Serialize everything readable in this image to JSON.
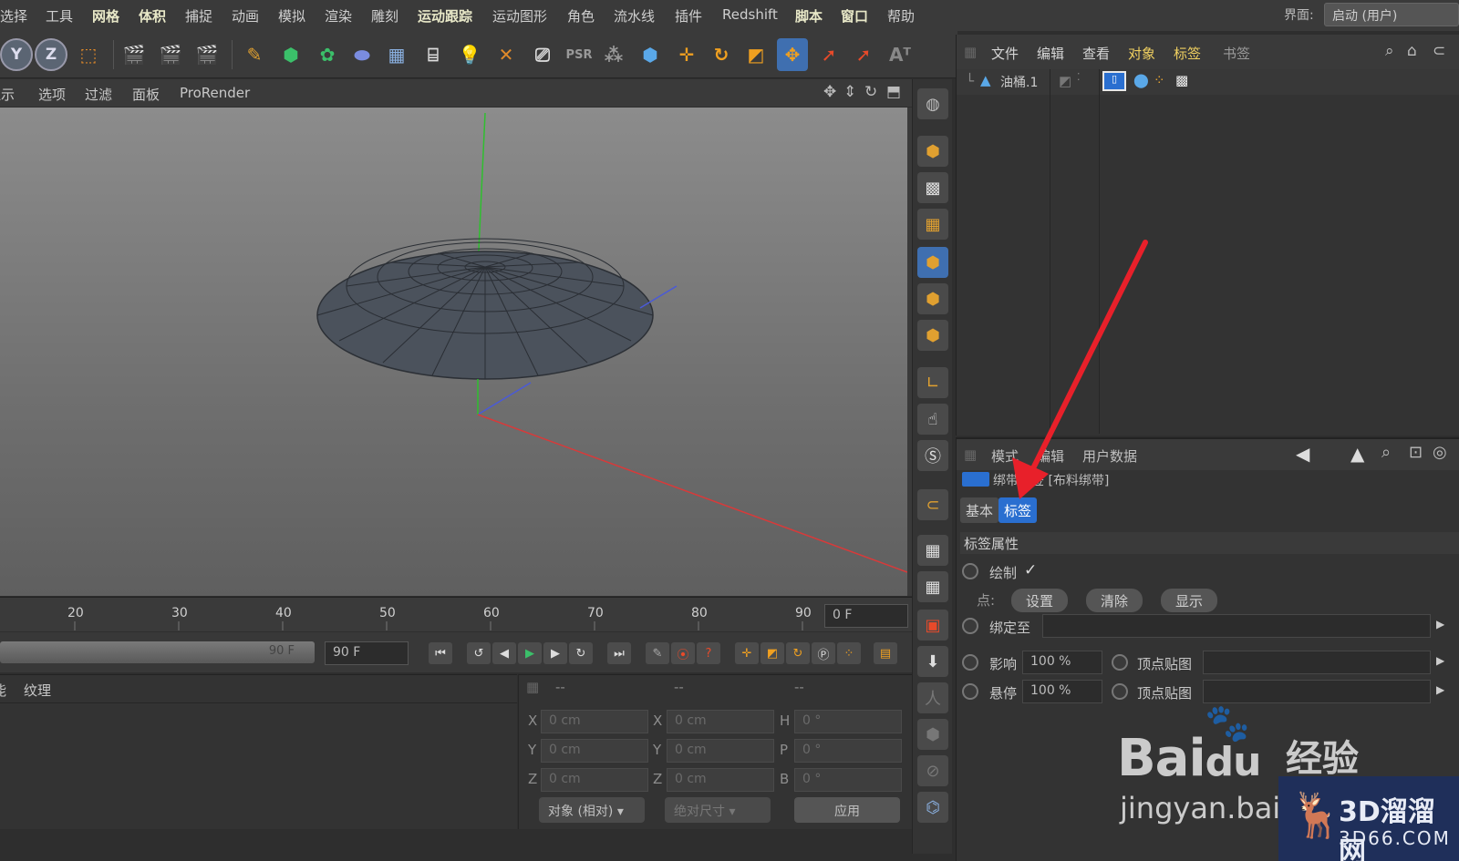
{
  "menubar": {
    "items": [
      {
        "label": "选择",
        "hl": false
      },
      {
        "label": "工具",
        "hl": false
      },
      {
        "label": "网格",
        "hl": true
      },
      {
        "label": "体积",
        "hl": true
      },
      {
        "label": "捕捉",
        "hl": false
      },
      {
        "label": "动画",
        "hl": false
      },
      {
        "label": "模拟",
        "hl": false
      },
      {
        "label": "渲染",
        "hl": false
      },
      {
        "label": "雕刻",
        "hl": false
      },
      {
        "label": "运动跟踪",
        "hl": true
      },
      {
        "label": "运动图形",
        "hl": false
      },
      {
        "label": "角色",
        "hl": false
      },
      {
        "label": "流水线",
        "hl": false
      },
      {
        "label": "插件",
        "hl": false
      },
      {
        "label": "Redshift",
        "hl": false
      },
      {
        "label": "脚本",
        "hl": true
      },
      {
        "label": "窗口",
        "hl": true
      },
      {
        "label": "帮助",
        "hl": false
      }
    ],
    "interface_label": "界面:",
    "interface_value": "启动 (用户)"
  },
  "toolbar": {
    "axis_y": "Y",
    "axis_z": "Z",
    "icons": [
      "coordinate-system-icon",
      "render-view-icon",
      "render-picture-viewer-icon",
      "render-settings-icon",
      "pen-icon",
      "cube-icon",
      "cloner-icon",
      "deformer-icon",
      "floor-icon",
      "camera-icon",
      "light-icon",
      "spline-icon",
      "effector-icon",
      "psr-icon",
      "xpresso-icon",
      "live-select-icon",
      "move-icon",
      "rotate-icon",
      "scale-icon",
      "transform-icon",
      "select-icon",
      "rect-select-icon",
      "text-icon"
    ]
  },
  "viewport_menu": {
    "items": [
      "显示",
      "选项",
      "过滤",
      "面板",
      "ProRender"
    ]
  },
  "timeline": {
    "ticks": [
      "20",
      "30",
      "40",
      "50",
      "60",
      "70",
      "80",
      "90"
    ],
    "current_frame": "0 F",
    "range_end_label": "90 F",
    "end_frame": "90 F"
  },
  "material_panel": {
    "tab_partial": "能",
    "tab_texture": "纹理"
  },
  "coord_panel": {
    "header_dashes": [
      "--",
      "--",
      "--"
    ],
    "rows": [
      {
        "pos_label": "X",
        "pos_value": "0 cm",
        "size_label": "X",
        "size_value": "0 cm",
        "rot_label": "H",
        "rot_value": "0 °"
      },
      {
        "pos_label": "Y",
        "pos_value": "0 cm",
        "size_label": "Y",
        "size_value": "0 cm",
        "rot_label": "P",
        "rot_value": "0 °"
      },
      {
        "pos_label": "Z",
        "pos_value": "0 cm",
        "size_label": "Z",
        "size_value": "0 cm",
        "rot_label": "B",
        "rot_value": "0 °"
      }
    ],
    "mode_select": "对象 (相对)",
    "size_select": "绝对尺寸",
    "apply_label": "应用"
  },
  "object_manager": {
    "menu": [
      "文件",
      "编辑",
      "查看",
      "对象",
      "标签",
      "书签"
    ],
    "object_name": "油桶.1"
  },
  "attribute_manager": {
    "menu": [
      "模式",
      "编辑",
      "用户数据"
    ],
    "title": "绑带标签 [布料绑带]",
    "tabs": [
      "基本",
      "标签"
    ],
    "active_tab": "标签",
    "section": "标签属性",
    "draw_label": "绘制",
    "draw_checked": "✓",
    "points_label": "点:",
    "btn_set": "设置",
    "btn_clear": "清除",
    "btn_show": "显示",
    "bind_to_label": "绑定至",
    "influence_label": "影响",
    "influence_value": "100 %",
    "hang_label": "悬停",
    "hang_value": "100 %",
    "vertex_map_label_1": "顶点贴图",
    "vertex_map_label_2": "顶点贴图"
  },
  "watermark": {
    "baidu": "Bai",
    "baidu_du": "du",
    "jingyan_cn": "经验",
    "jingyan_url": "jingyan.bai",
    "site_title": "3D溜溜网",
    "site_domain": "3D66.COM"
  },
  "colors": {
    "highlight_blue": "#2a6fd0",
    "arrow_red": "#e8202a",
    "axis_green": "#2fbf2f",
    "axis_red": "#d83a3a",
    "axis_blue": "#4a5ad8"
  }
}
